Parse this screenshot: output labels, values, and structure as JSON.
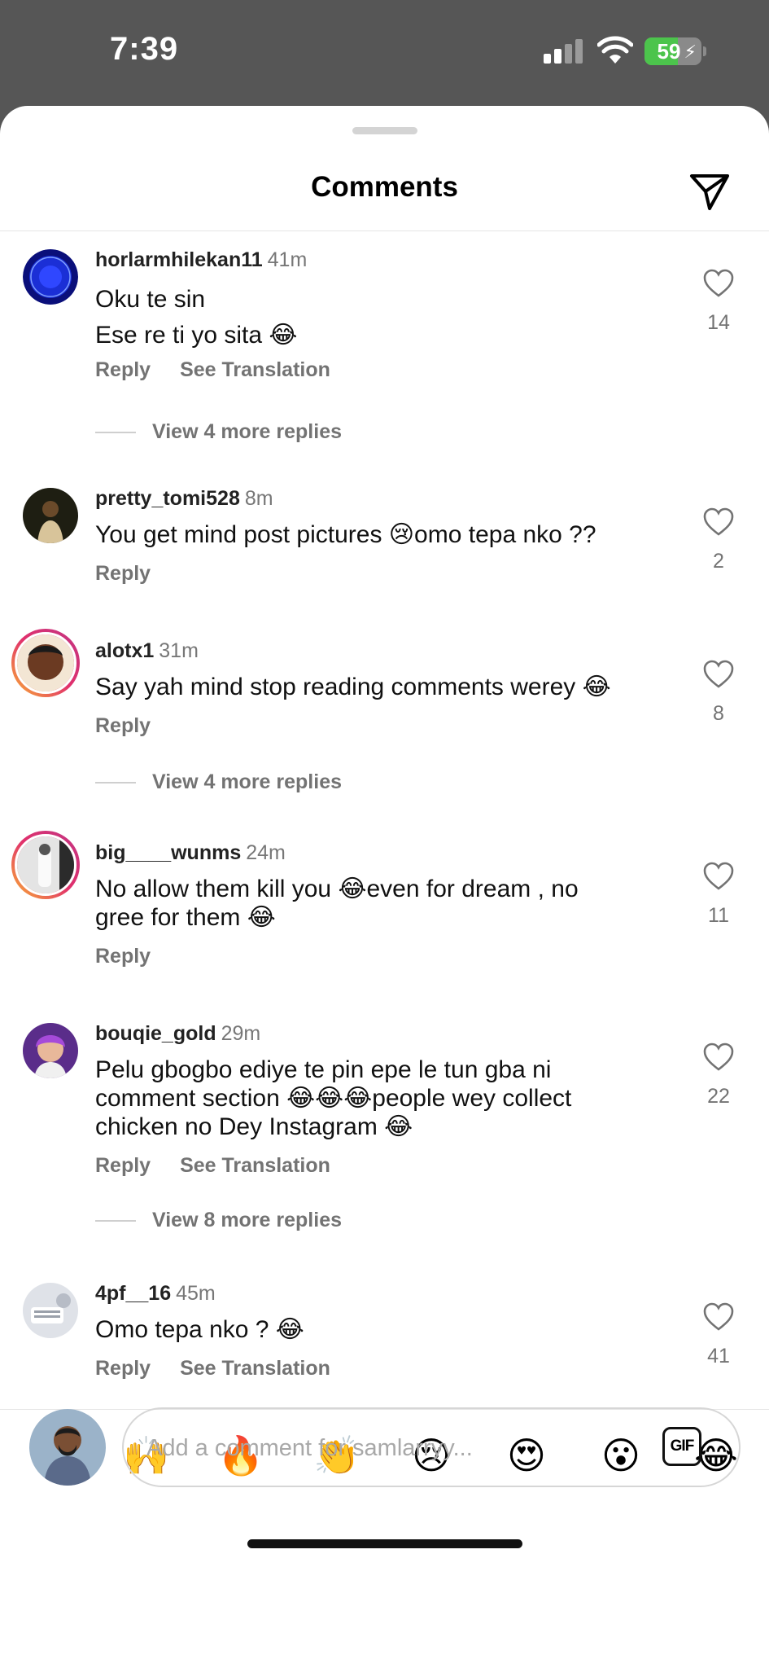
{
  "status_bar": {
    "time": "7:39",
    "battery": "59",
    "battery_level": 0.59
  },
  "header": {
    "title": "Comments"
  },
  "comments": [
    {
      "user": "horlarmhilekan11",
      "time": "41m",
      "text": "Oku te sin\nEse re ti yo sita 😂",
      "likes": "14",
      "reply": "Reply",
      "translate": "See Translation",
      "more_replies": "View 4 more replies",
      "avatar_color": "#1b2fd6"
    },
    {
      "user": "pretty_tomi528",
      "time": "8m",
      "text": "You get mind post pictures 😢omo tepa nko ??",
      "likes": "2",
      "reply": "Reply",
      "avatar_color": "#2a2a1c"
    },
    {
      "user": "alotx1",
      "time": "31m",
      "text": "Say yah mind stop reading comments werey 😂",
      "likes": "8",
      "reply": "Reply",
      "more_replies": "View 4 more replies",
      "avatar_color": "#6b3a22"
    },
    {
      "user": "big____wunms",
      "time": "24m",
      "text": "No allow them kill you 😂even for dream , no\ngree for them 😂",
      "likes": "11",
      "reply": "Reply",
      "avatar_color": "#d9d9d9"
    },
    {
      "user": "bouqie_gold",
      "time": "29m",
      "text": "Pelu gbogbo ediye te pin epe le tun gba ni\ncomment section 😂😂😂people wey collect\nchicken no Dey Instagram 😂",
      "likes": "22",
      "reply": "Reply",
      "translate": "See Translation",
      "more_replies": "View 8 more replies",
      "avatar_color": "#7a3fb0"
    },
    {
      "user": "4pf__16",
      "time": "45m",
      "text": "Omo tepa nko ? 😂",
      "likes": "41",
      "reply": "Reply",
      "translate": "See Translation",
      "avatar_color": "#c9ccd2"
    }
  ],
  "reactions": [
    "❤️",
    "🙌",
    "🔥",
    "👏",
    "😢",
    "😍",
    "😮",
    "😂"
  ],
  "composer": {
    "placeholder": "Add a comment for samlarryy...",
    "gif_label": "GIF"
  },
  "colors": {
    "accent_heart": "#e0245e",
    "muted": "#737373",
    "status_bg": "#565656"
  }
}
